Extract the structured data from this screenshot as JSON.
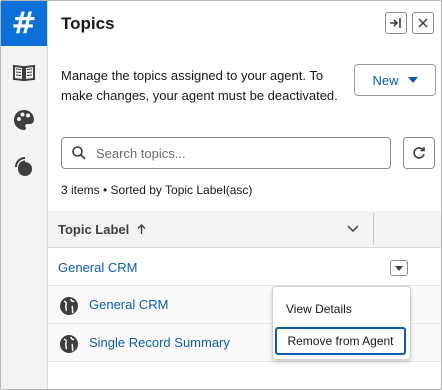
{
  "rail": {
    "logo_glyph": "#",
    "accent_color": "#0b6fd8",
    "icons": [
      "book-icon",
      "palette-icon",
      "signal-icon"
    ]
  },
  "header": {
    "title": "Topics",
    "dock_icon": "dock-right-icon",
    "close_icon": "close-icon"
  },
  "description": "Manage the topics assigned to your agent. To make changes, your agent must be deactivated.",
  "new_button": {
    "label": "New",
    "icon": "caret-down-icon"
  },
  "search": {
    "placeholder": "Search topics...",
    "value": ""
  },
  "refresh_icon": "refresh-icon",
  "list_meta": "3 items • Sorted by Topic Label(asc)",
  "table": {
    "column_header": "Topic Label",
    "sort_icon": "arrow-up-icon",
    "rows": [
      {
        "label": "General CRM",
        "type": "group"
      },
      {
        "label": "General CRM",
        "type": "item",
        "icon": "globe-icon"
      },
      {
        "label": "Single Record Summary",
        "type": "item",
        "icon": "globe-icon"
      }
    ]
  },
  "row_menu": {
    "items": [
      "View Details",
      "Remove from Agent"
    ],
    "focused_item": "Remove from Agent"
  },
  "colors": {
    "link": "#0b5cab",
    "focus_border": "#0b5cab"
  }
}
